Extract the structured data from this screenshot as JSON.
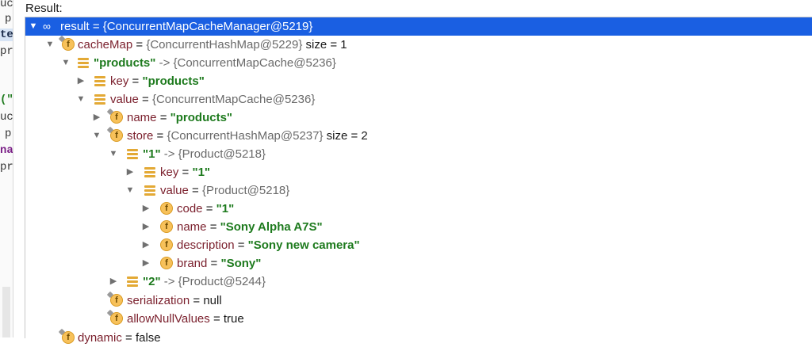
{
  "gutter": {
    "fragments": [
      "uc",
      "p",
      "te",
      "pr",
      "(\"",
      "uc",
      "p",
      "na",
      "pr"
    ]
  },
  "header": {
    "label": "Result:"
  },
  "tree": {
    "rows": [
      {
        "name": "result",
        "eq": " = ",
        "value": "{ConcurrentMapCacheManager@5219}",
        "extra": ""
      },
      {
        "name": "cacheMap",
        "eq": " = ",
        "value": "{ConcurrentHashMap@5229}",
        "extra": "  size = 1"
      },
      {
        "name": "\"products\"",
        "eq": " -> ",
        "value": "{ConcurrentMapCache@5236}",
        "extra": ""
      },
      {
        "name": "key",
        "eq": " = ",
        "value": "\"products\"",
        "extra": ""
      },
      {
        "name": "value",
        "eq": " = ",
        "value": "{ConcurrentMapCache@5236}",
        "extra": ""
      },
      {
        "name": "name",
        "eq": " = ",
        "value": "\"products\"",
        "extra": ""
      },
      {
        "name": "store",
        "eq": " = ",
        "value": "{ConcurrentHashMap@5237}",
        "extra": "  size = 2"
      },
      {
        "name": "\"1\"",
        "eq": " -> ",
        "value": "{Product@5218}",
        "extra": ""
      },
      {
        "name": "key",
        "eq": " = ",
        "value": "\"1\"",
        "extra": ""
      },
      {
        "name": "value",
        "eq": " = ",
        "value": "{Product@5218}",
        "extra": ""
      },
      {
        "name": "code",
        "eq": " = ",
        "value": "\"1\"",
        "extra": ""
      },
      {
        "name": "name",
        "eq": " = ",
        "value": "\"Sony Alpha A7S\"",
        "extra": ""
      },
      {
        "name": "description",
        "eq": " = ",
        "value": "\"Sony new camera\"",
        "extra": ""
      },
      {
        "name": "brand",
        "eq": " = ",
        "value": "\"Sony\"",
        "extra": ""
      },
      {
        "name": "\"2\"",
        "eq": " -> ",
        "value": "{Product@5244}",
        "extra": ""
      },
      {
        "name": "serialization",
        "eq": " = ",
        "value": "null",
        "extra": ""
      },
      {
        "name": "allowNullValues",
        "eq": " = ",
        "value": "true",
        "extra": ""
      },
      {
        "name": "dynamic",
        "eq": " = ",
        "value": "false",
        "extra": ""
      }
    ]
  },
  "colors": {
    "selection": "#1a5fe2",
    "field_name": "#7a1f2c",
    "string_value": "#1d7a1d",
    "reference_value": "#6a6a6a",
    "field_icon": "#f7c15a"
  },
  "icons": {
    "field": "field-icon",
    "map_entry": "map-entry-icon",
    "watch": "watch-glasses-icon",
    "expanded": "triangle-down-icon",
    "collapsed": "triangle-right-icon"
  }
}
